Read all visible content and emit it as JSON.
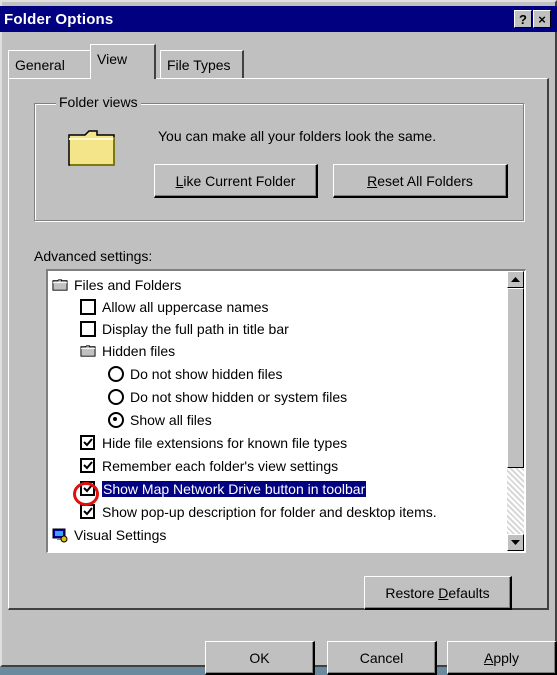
{
  "window": {
    "title": "Folder Options",
    "help_label": "?",
    "close_label": "×"
  },
  "tabs": [
    {
      "label": "General",
      "selected": false
    },
    {
      "label": "View",
      "selected": true
    },
    {
      "label": "File Types",
      "selected": false
    }
  ],
  "folder_views": {
    "group_label": "Folder views",
    "description": "You can make all your folders look the same.",
    "like_current_prefix": "L",
    "like_current_rest": "ike Current Folder",
    "reset_prefix": "R",
    "reset_rest": "eset All Folders"
  },
  "advanced": {
    "label": "Advanced settings:",
    "items": [
      {
        "label": "Files and Folders",
        "kind": "folder"
      },
      {
        "label": "Allow all uppercase names",
        "kind": "checkbox",
        "checked": false
      },
      {
        "label": "Display the full path in title bar",
        "kind": "checkbox",
        "checked": false
      },
      {
        "label": "Hidden files",
        "kind": "folder"
      },
      {
        "label": "Do not show hidden files",
        "kind": "radio",
        "checked": false
      },
      {
        "label": "Do not show hidden or system files",
        "kind": "radio",
        "checked": false
      },
      {
        "label": "Show all files",
        "kind": "radio",
        "checked": true
      },
      {
        "label": "Hide file extensions for known file types",
        "kind": "checkbox",
        "checked": true
      },
      {
        "label": "Remember each folder's view settings",
        "kind": "checkbox",
        "checked": true
      },
      {
        "label": "Show Map Network Drive button in toolbar",
        "kind": "checkbox",
        "checked": true,
        "selected": true
      },
      {
        "label": "Show pop-up description for folder and desktop items.",
        "kind": "checkbox",
        "checked": true
      },
      {
        "label": "Visual Settings",
        "kind": "settings"
      }
    ]
  },
  "buttons": {
    "restore_prefix": "Restore ",
    "restore_underlined": "D",
    "restore_rest": "efaults",
    "ok": "OK",
    "cancel": "Cancel",
    "apply_underlined": "A",
    "apply_rest": "pply"
  },
  "colors": {
    "titlebar": "#000080",
    "face": "#c0c0c0",
    "selection": "#000080",
    "annotation_circle": "#e01010"
  }
}
